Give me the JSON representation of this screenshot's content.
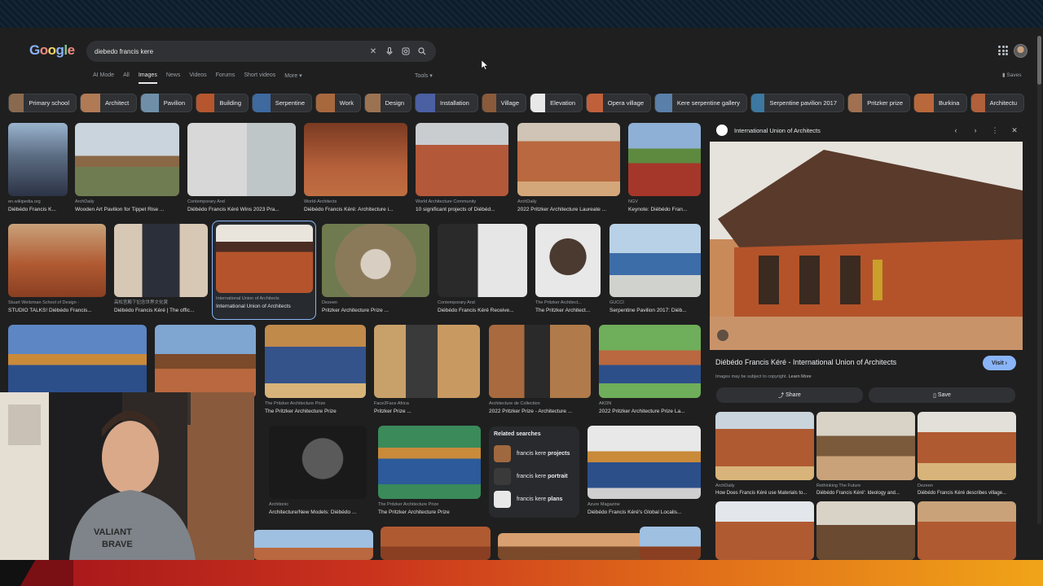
{
  "search": {
    "query": "diebedo francis kere"
  },
  "header": {
    "logo": "Google",
    "tools": "Tools ▾",
    "saves": "Saves"
  },
  "tabs": [
    "AI Mode",
    "All",
    "Images",
    "News",
    "Videos",
    "Forums",
    "Short videos",
    "More ▾"
  ],
  "chips": [
    {
      "label": "Primary school",
      "color": "#8a6a4f"
    },
    {
      "label": "Architect",
      "color": "#b07a55"
    },
    {
      "label": "Pavilion",
      "color": "#6f8fa8"
    },
    {
      "label": "Building",
      "color": "#b5562e"
    },
    {
      "label": "Serpentine",
      "color": "#3e6aa0"
    },
    {
      "label": "Work",
      "color": "#a8683e"
    },
    {
      "label": "Design",
      "color": "#9c7352"
    },
    {
      "label": "Installation",
      "color": "#4b5fa3"
    },
    {
      "label": "Village",
      "color": "#8a5a3a"
    },
    {
      "label": "Elevation",
      "color": "#e8e8e8"
    },
    {
      "label": "Opera village",
      "color": "#c0603a"
    },
    {
      "label": "Kere serpentine gallery",
      "color": "#5a7fa8"
    },
    {
      "label": "Serpentine pavilion 2017",
      "color": "#3d78a0"
    },
    {
      "label": "Pritzker prize",
      "color": "#a07050"
    },
    {
      "label": "Burkina",
      "color": "#b8683a"
    },
    {
      "label": "Architectu",
      "color": "#b0603a"
    }
  ],
  "results": [
    {
      "src": "en.wikipedia.org",
      "title": "Diébédo Francis K...",
      "bg": "linear-gradient(180deg,#9ab4cf 0%,#5b6c82 45%,#2c3346 100%)"
    },
    {
      "src": "ArchDaily",
      "title": "Wooden Art Pavilion for Tippet Rise ...",
      "bg": "linear-gradient(180deg,#c9d4dc 0 45%,#8a6846 45% 60%,#6f7c52 60% 100%)"
    },
    {
      "src": "Contemporary And",
      "title": "Diébédo Francis Kéré Wins 2023 Pra...",
      "bg": "linear-gradient(90deg,#d8d8d8 0 55%,#bfc6c8 55% 100%)"
    },
    {
      "src": "World-Architects",
      "title": "Diébédo Francis Kéré: Architecture i...",
      "bg": "linear-gradient(180deg,#7a3a22 0%,#b5603a 60%,#c06e42 100%)"
    },
    {
      "src": "World Architecture Community",
      "title": "10 significant projects of Diébéd...",
      "bg": "linear-gradient(180deg,#c9cdd0 0 30%,#b4583a 30% 100%)"
    },
    {
      "src": "ArchDaily",
      "title": "2022 Pritzker Architecture Laureate ...",
      "bg": "linear-gradient(180deg,#cfc4b5 0 25%,#b9683f 25% 80%,#d4a77a 80% 100%)"
    },
    {
      "src": "NGV",
      "title": "Keynote: Diébédo Fran...",
      "bg": "linear-gradient(180deg,#8fb0d6 0 35%,#5d8a3f 35% 55%,#a5372a 55% 100%)"
    },
    {
      "src": "Stuart Weitzman School of Design -",
      "title": "STUDIO TALKS! Diébédo Francis...",
      "bg": "linear-gradient(180deg,#c9a27a 0%,#b05a32 55%,#8a3f22 100%)"
    },
    {
      "src": "高松宮殿下記念世界文化賞",
      "title": "Diébédo Francis Kéré | The offic...",
      "bg": "linear-gradient(90deg,#d6c8b4 0 30%,#2b2f3a 30% 70%,#d6c8b4 70% 100%)"
    },
    {
      "src": "International Union of Architects",
      "title": "International Union of Architects",
      "bg": "linear-gradient(180deg,#e9e5dd 0 25%,#4b2c22 25% 40%,#b5542c 40% 100%)"
    },
    {
      "src": "Dezeen",
      "title": "Pritzker Architecture Prize ...",
      "bg": "radial-gradient(circle at 50% 55%,#d8cfc2 0 22%,#8b7a5a 23% 60%,#6f7a4f 61% 100%)"
    },
    {
      "src": "Contemporary And",
      "title": "Diébédo Francis Kéré Receive...",
      "bg": "linear-gradient(90deg,#2a2a2a 0 45%,#e6e6e6 45% 100%)"
    },
    {
      "src": "The Pritzker Architect...",
      "title": "The Pritzker Architect...",
      "bg": "radial-gradient(circle at 50% 45%,#4b3a30 0 35%,#e8e8e8 36% 100%)"
    },
    {
      "src": "GUCCI",
      "title": "Serpentine Pavilion 2017: Diéb...",
      "bg": "linear-gradient(180deg,#b9d1e6 0 40%,#3c6da8 40% 70%,#cfd2cd 70% 100%)"
    },
    {
      "src": "",
      "title": "",
      "bg": "linear-gradient(180deg,#5d86c4 0 40%,#c98a3a 40% 55%,#2c4f8a 55% 100%)"
    },
    {
      "src": "",
      "title": "",
      "bg": "linear-gradient(180deg,#7fa6d0 0 40%,#7a4a2a 40% 60%,#b9683f 60% 100%)"
    },
    {
      "src": "The Pritzker Architecture Prize",
      "title": "The Pritzker Architecture Prize",
      "bg": "linear-gradient(180deg,#c08a4a 0 30%,#34538a 30% 80%,#d8b47a 80% 100%)"
    },
    {
      "src": "Face2Face Africa",
      "title": "Pritzker Prize ...",
      "bg": "linear-gradient(90deg,#c8a06a 0 30%,#3a3a3a 30% 60%,#c89a62 60% 100%)"
    },
    {
      "src": "Architecture de Collection",
      "title": "2022 Pritzker Prize - Architecture ...",
      "bg": "linear-gradient(90deg,#a86a3e 0 35%,#2a2a2a 35% 60%,#b07a4a 60% 100%)"
    },
    {
      "src": "AKDN",
      "title": "2022 Pritzker Architecture Prize La...",
      "bg": "linear-gradient(180deg,#6fae5a 0 35%,#b9683f 35% 55%,#2c4f8a 55% 80%,#6fae5a 80% 100%)"
    },
    {
      "src": "Architonic",
      "title": "Architecture/New Models: Diébédo ...",
      "bg": "radial-gradient(circle at 55% 45%,#5a5a5a 0 30%,#1a1a1a 31% 100%)"
    },
    {
      "src": "The Pritzker Architecture Prize",
      "title": "The Pritzker Architecture Prize",
      "bg": "linear-gradient(180deg,#3a8a5a 0 30%,#c98a3a 30% 45%,#2c5a9a 45% 80%,#3a8a5a 80% 100%)"
    },
    {
      "src": "Azure Magazine",
      "title": "Diébédo Francis Kéré's Global Localis...",
      "bg": "linear-gradient(180deg,#e8e8e8 0 35%,#c98a3a 35% 50%,#2c4f8a 50% 85%,#cfcfcf 85% 100%)"
    },
    {
      "src": "",
      "title": "",
      "bg": "linear-gradient(180deg,#c9d9e6 0 60%,#7a8a5a 60% 100%)"
    },
    {
      "src": "",
      "title": "",
      "bg": "linear-gradient(180deg,#e6e6e6 0 50%,#3a3a3a 50% 100%)"
    },
    {
      "src": "",
      "title": "",
      "bg": "linear-gradient(180deg,#9fc0e0 0 60%,#b9683f 60% 100%)"
    },
    {
      "src": "",
      "title": "",
      "bg": "linear-gradient(180deg,#b05a32 0 60%,#8a3f22 60% 100%)"
    },
    {
      "src": "",
      "title": "",
      "bg": "linear-gradient(180deg,#d8a070 0 50%,#7a4a2a 50% 100%)"
    },
    {
      "src": "",
      "title": "",
      "bg": "linear-gradient(180deg,#9fc0e0 0 60%,#8a3f22 60% 100%)"
    }
  ],
  "related": {
    "heading": "Related searches",
    "items": [
      {
        "pre": "francis kere ",
        "bold": "projects",
        "color": "#a0683e"
      },
      {
        "pre": "francis kere ",
        "bold": "portrait",
        "color": "#3a3a3a"
      },
      {
        "pre": "francis kere ",
        "bold": "plans",
        "color": "#e8e8e8"
      }
    ]
  },
  "panel": {
    "site": "International Union of Architects",
    "title": "Diébédo Francis Kéré - International Union of Architects",
    "note": "Images may be subject to copyright.",
    "learn_more": "Learn More",
    "visit": "Visit",
    "share": "Share",
    "save": "Save",
    "related": [
      {
        "src": "ArchDaily",
        "title": "How Does Francis Kéré use Materials to...",
        "bg": "linear-gradient(180deg,#c9d4dc 0 25%,#b05a32 25% 80%,#d8b47a 80% 100%)"
      },
      {
        "src": "Rethinking The Future",
        "title": "Diébédo Francis Kéré': Ideology and...",
        "bg": "linear-gradient(180deg,#d8d3c6 0 35%,#7a5a3a 35% 65%,#c9a27a 65% 100%)"
      },
      {
        "src": "Dezeen",
        "title": "Diébédo Francis Kéré describes village...",
        "bg": "linear-gradient(180deg,#e3e0da 0 30%,#b05a32 30% 75%,#d8b47a 75% 100%)"
      },
      {
        "src": "",
        "title": "",
        "bg": "linear-gradient(180deg,#e3e6ea 0 35%,#b05a32 35% 100%)"
      },
      {
        "src": "",
        "title": "",
        "bg": "linear-gradient(180deg,#d8d3c6 0 40%,#6a4a30 40% 100%)"
      },
      {
        "src": "",
        "title": "",
        "bg": "linear-gradient(180deg,#c9a27a 0 35%,#b05a32 35% 100%)"
      }
    ]
  },
  "webcam": {
    "shirt_text": "VALIANT BRAVE"
  },
  "colors": {
    "background": "#1f1f1f",
    "accent": "#8ab4f8",
    "frame_bottom": "#c9321d"
  }
}
